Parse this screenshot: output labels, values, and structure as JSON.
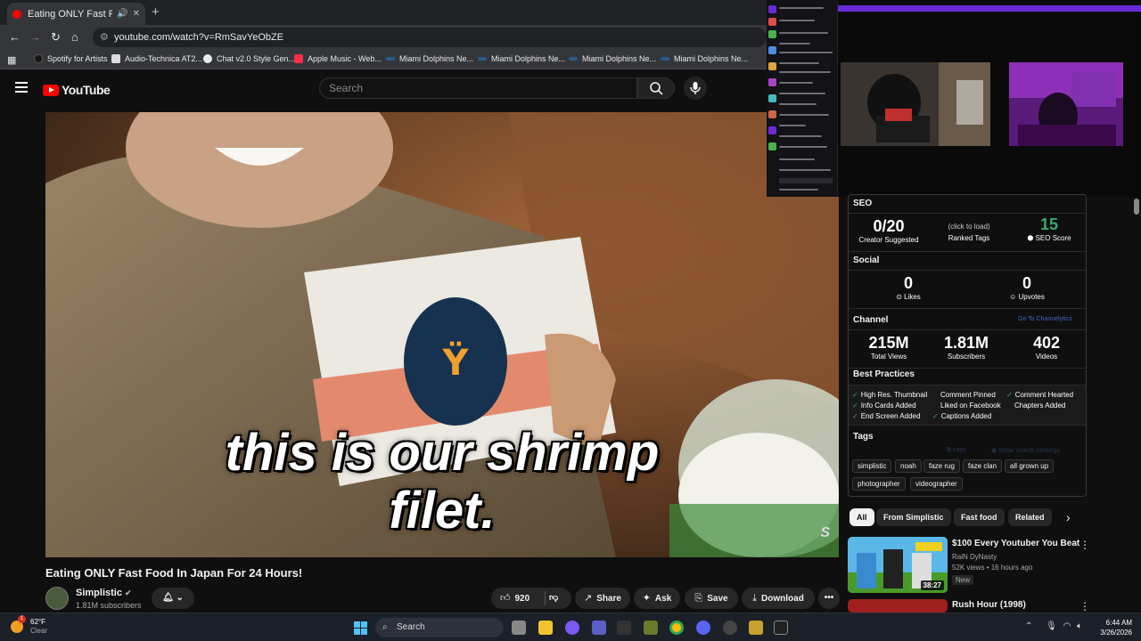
{
  "browser": {
    "tab_title": "Eating ONLY Fast Food In Ja",
    "url": "youtube.com/watch?v=RmSavYeObZE",
    "bookmarks": [
      "Spotify for Artists",
      "Audio-Technica AT2...",
      "Chat v2.0 Style Gen...",
      "Apple Music - Web...",
      "Miami Dolphins Ne...",
      "Miami Dolphins Ne...",
      "Miami Dolphins Ne...",
      "Miami Dolphins Ne..."
    ]
  },
  "youtube": {
    "logo_text": "YouTube",
    "search_placeholder": "Search",
    "caption_line1": "this is our shrimp",
    "caption_line2": "filet.",
    "video_title": "Eating ONLY Fast Food In Japan For 24 Hours!",
    "channel_name": "Simplistic",
    "subscribers": "1.81M subscribers",
    "actions": {
      "likes": "920",
      "share": "Share",
      "ask": "Ask",
      "save": "Save",
      "download": "Download"
    }
  },
  "seo_panel": {
    "seo_heading": "SEO",
    "creator_suggested_value": "0/20",
    "creator_suggested_label": "Creator Suggested",
    "ranked_tags_hint": "(click to load)",
    "ranked_tags_label": "Ranked Tags",
    "seo_score_value": "15",
    "seo_score_label": "SEO Score",
    "social_heading": "Social",
    "likes_value": "0",
    "likes_label": "Likes",
    "upvotes_value": "0",
    "upvotes_label": "Upvotes",
    "channel_heading": "Channel",
    "channel_link": "Go To Channelytics",
    "total_views_value": "215M",
    "total_views_label": "Total Views",
    "subscribers_value": "1.81M",
    "subscribers_label": "Subscribers",
    "videos_value": "402",
    "videos_label": "Videos",
    "best_practices_heading": "Best Practices",
    "best_practices": [
      "High Res. Thumbnail",
      "Comment Pinned",
      "Comment Hearted",
      "Info Cards Added",
      "Liked on Facebook",
      "Chapters Added",
      "End Screen Added",
      "Captions Added"
    ],
    "tags_heading": "Tags",
    "copy_label": "copy",
    "show_rankings_label": "Show search rankings",
    "tags": [
      "simplistic",
      "noah",
      "faze rug",
      "faze clan",
      "all grown up",
      "photographer",
      "videographer"
    ]
  },
  "chips": [
    "All",
    "From Simplistic",
    "Fast food",
    "Related"
  ],
  "recommendations": [
    {
      "title": "$100 Every Youtuber You Beat",
      "channel": "RaiN DyNasty",
      "meta": "52K views • 16 hours ago",
      "badge": "New",
      "duration": "38:27"
    },
    {
      "title": "Rush Hour (1998)"
    }
  ],
  "taskbar": {
    "weather_temp": "62°F",
    "weather_desc": "Clear",
    "weather_badge": "1",
    "search_label": "Search",
    "time": "6:44 AM",
    "date": "3/26/2026"
  },
  "colors": {
    "youtube_red": "#ff0000",
    "seo_green": "#3ea66f",
    "overlay_purple": "#6a2bd6"
  }
}
